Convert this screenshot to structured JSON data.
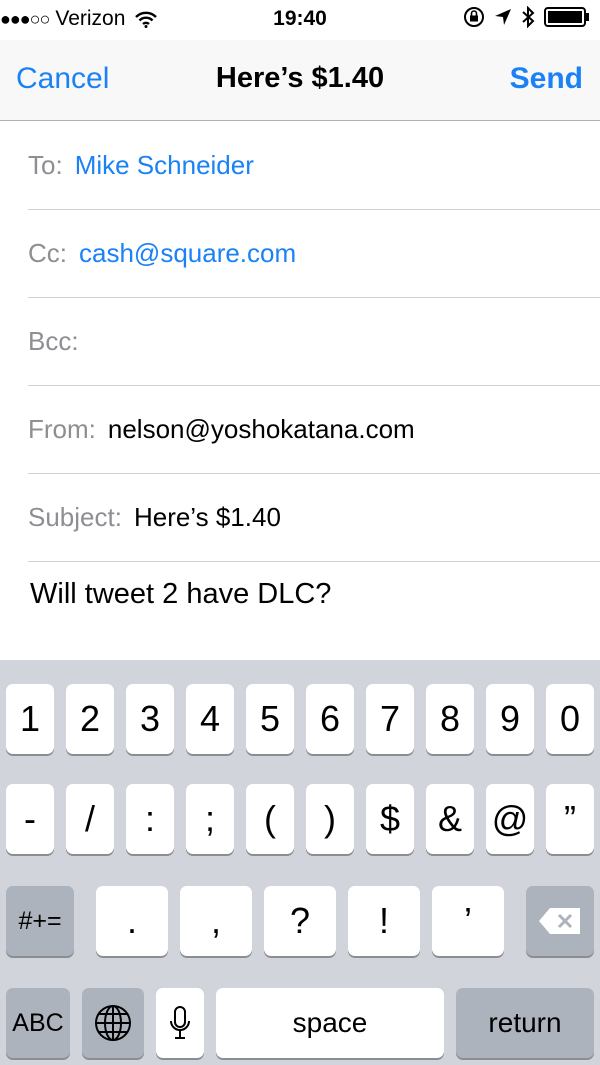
{
  "status_bar": {
    "carrier": "Verizon",
    "signal_dots": "●●●○○",
    "time": "19:40"
  },
  "nav": {
    "cancel": "Cancel",
    "title": "Here’s $1.40",
    "send": "Send"
  },
  "fields": {
    "to_label": "To:",
    "to_value": "Mike Schneider",
    "cc_label": "Cc:",
    "cc_value": "cash@square.com",
    "bcc_label": "Bcc:",
    "from_label": "From:",
    "from_value": "nelson@yoshokatana.com",
    "subject_label": "Subject:",
    "subject_value": "Here’s $1.40"
  },
  "body": "Will tweet 2 have DLC?",
  "keyboard": {
    "row1": [
      "1",
      "2",
      "3",
      "4",
      "5",
      "6",
      "7",
      "8",
      "9",
      "0"
    ],
    "row2": [
      "-",
      "/",
      ":",
      ";",
      "(",
      ")",
      "$",
      "&",
      "@",
      "”"
    ],
    "row3": [
      ".",
      ",",
      "?",
      "!",
      "’"
    ],
    "symbols_key": "#+=",
    "abc_key": "ABC",
    "space_key": "space",
    "return_key": "return"
  },
  "colors": {
    "accent": "#1a82f6",
    "label_gray": "#8e8e93",
    "keyboard_bg": "#d1d5db"
  }
}
